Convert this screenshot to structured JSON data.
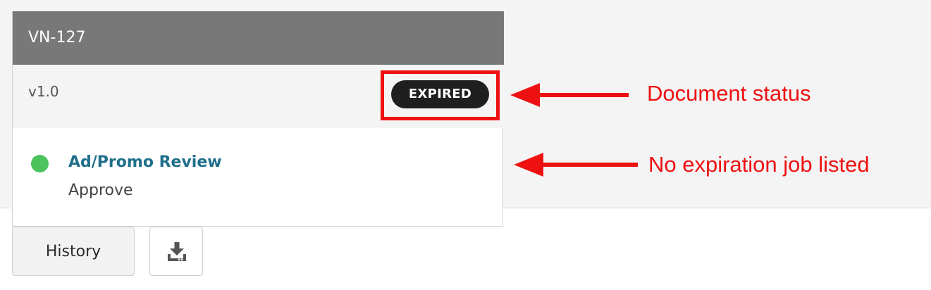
{
  "card": {
    "id": "VN-127",
    "version": "v1.0",
    "status": "EXPIRED",
    "status_color": "#1f1f1f",
    "workflow": {
      "name": "Ad/Promo Review",
      "task": "Approve",
      "indicator_color": "#4cc35d"
    }
  },
  "actions": {
    "history_label": "History",
    "download_icon": "download-icon"
  },
  "annotations": {
    "status_label": "Document status",
    "expiration_label": "No expiration job listed",
    "color": "#ee1111"
  }
}
